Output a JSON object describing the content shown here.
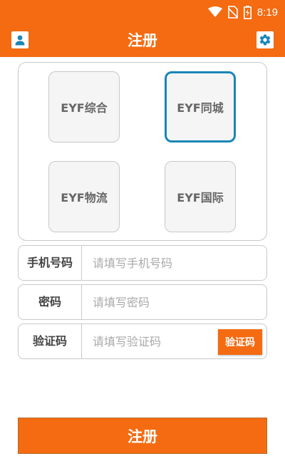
{
  "status_bar": {
    "time": "8:19",
    "icons": [
      "wifi-icon",
      "no-sim-icon",
      "battery-charging-icon"
    ]
  },
  "app_bar": {
    "title": "注册",
    "left_icon": "user-icon",
    "right_icon": "gear-icon"
  },
  "services": [
    {
      "label": "EYF综合",
      "selected": false
    },
    {
      "label": "EYF同城",
      "selected": true
    },
    {
      "label": "EYF物流",
      "selected": false
    },
    {
      "label": "EYF国际",
      "selected": false
    }
  ],
  "form": {
    "phone": {
      "label": "手机号码",
      "placeholder": "请填写手机号码",
      "value": ""
    },
    "password": {
      "label": "密码",
      "placeholder": "请填写密码",
      "value": ""
    },
    "code": {
      "label": "验证码",
      "placeholder": "请填写验证码",
      "value": "",
      "button_label": "验证码"
    }
  },
  "submit_label": "注册",
  "colors": {
    "accent": "#f46b12",
    "selected_border": "#1a86b8",
    "tile_bg": "#f5f5f5"
  }
}
